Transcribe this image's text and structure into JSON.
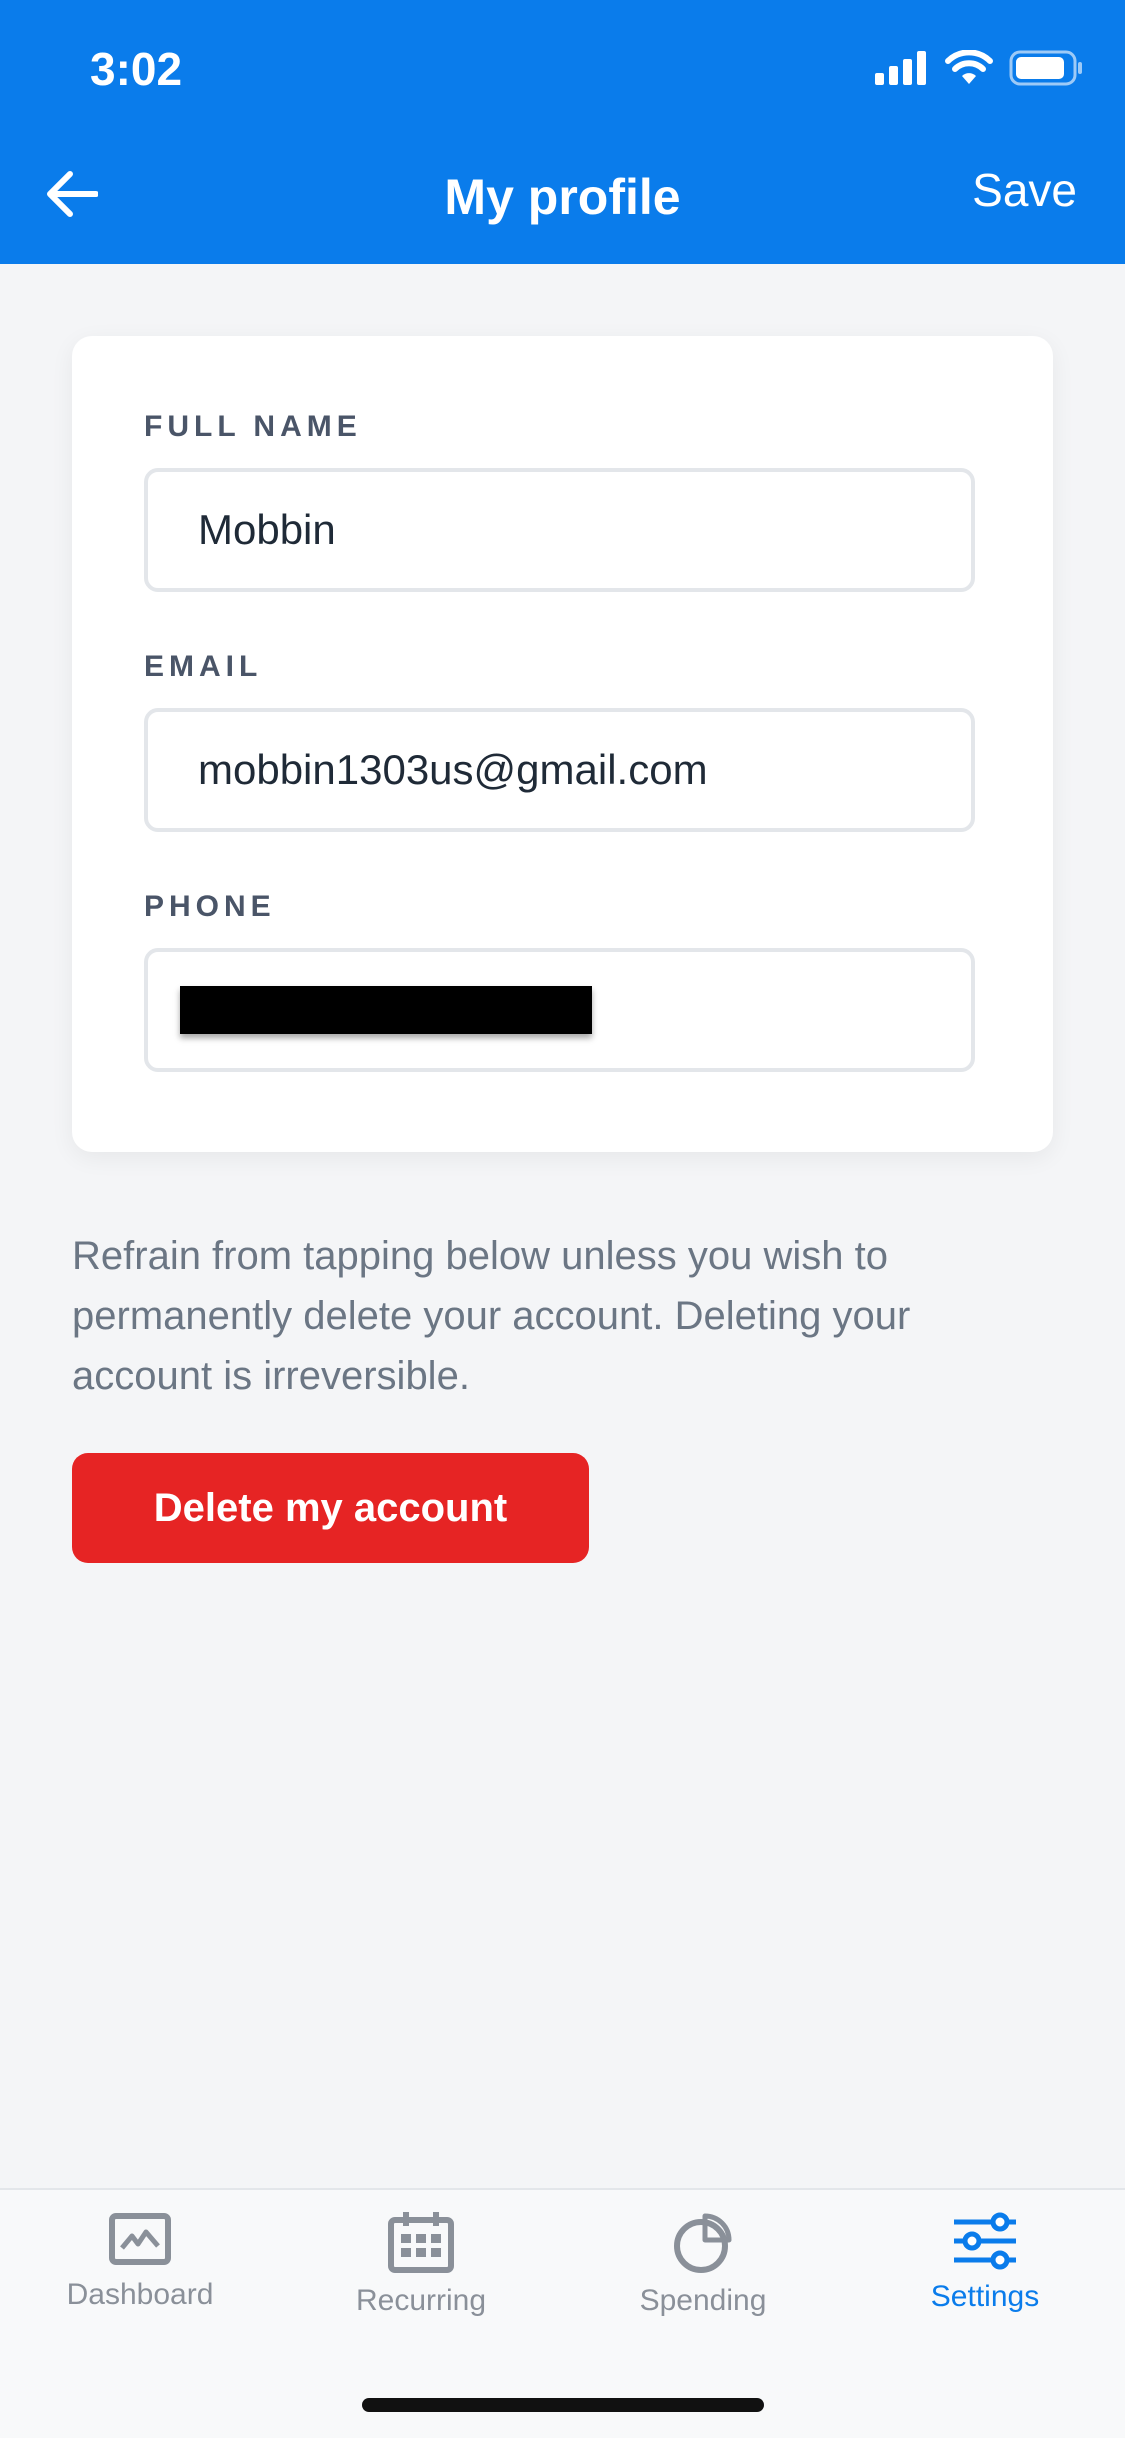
{
  "status_bar": {
    "time": "3:02"
  },
  "header": {
    "title": "My profile",
    "save_label": "Save"
  },
  "form": {
    "full_name": {
      "label": "FULL NAME",
      "value": "Mobbin"
    },
    "email": {
      "label": "EMAIL",
      "value": "mobbin1303us@gmail.com"
    },
    "phone": {
      "label": "PHONE",
      "value": ""
    }
  },
  "warning": {
    "text": "Refrain from tapping below unless you wish to permanently delete your account. Deleting your account is irreversible."
  },
  "delete_button": {
    "label": "Delete my account"
  },
  "tabs": [
    {
      "label": "Dashboard",
      "icon": "dashboard-icon"
    },
    {
      "label": "Recurring",
      "icon": "calendar-icon"
    },
    {
      "label": "Spending",
      "icon": "pie-chart-icon"
    },
    {
      "label": "Settings",
      "icon": "sliders-icon"
    }
  ],
  "colors": {
    "accent": "#0a7ceb",
    "danger": "#e62424"
  }
}
